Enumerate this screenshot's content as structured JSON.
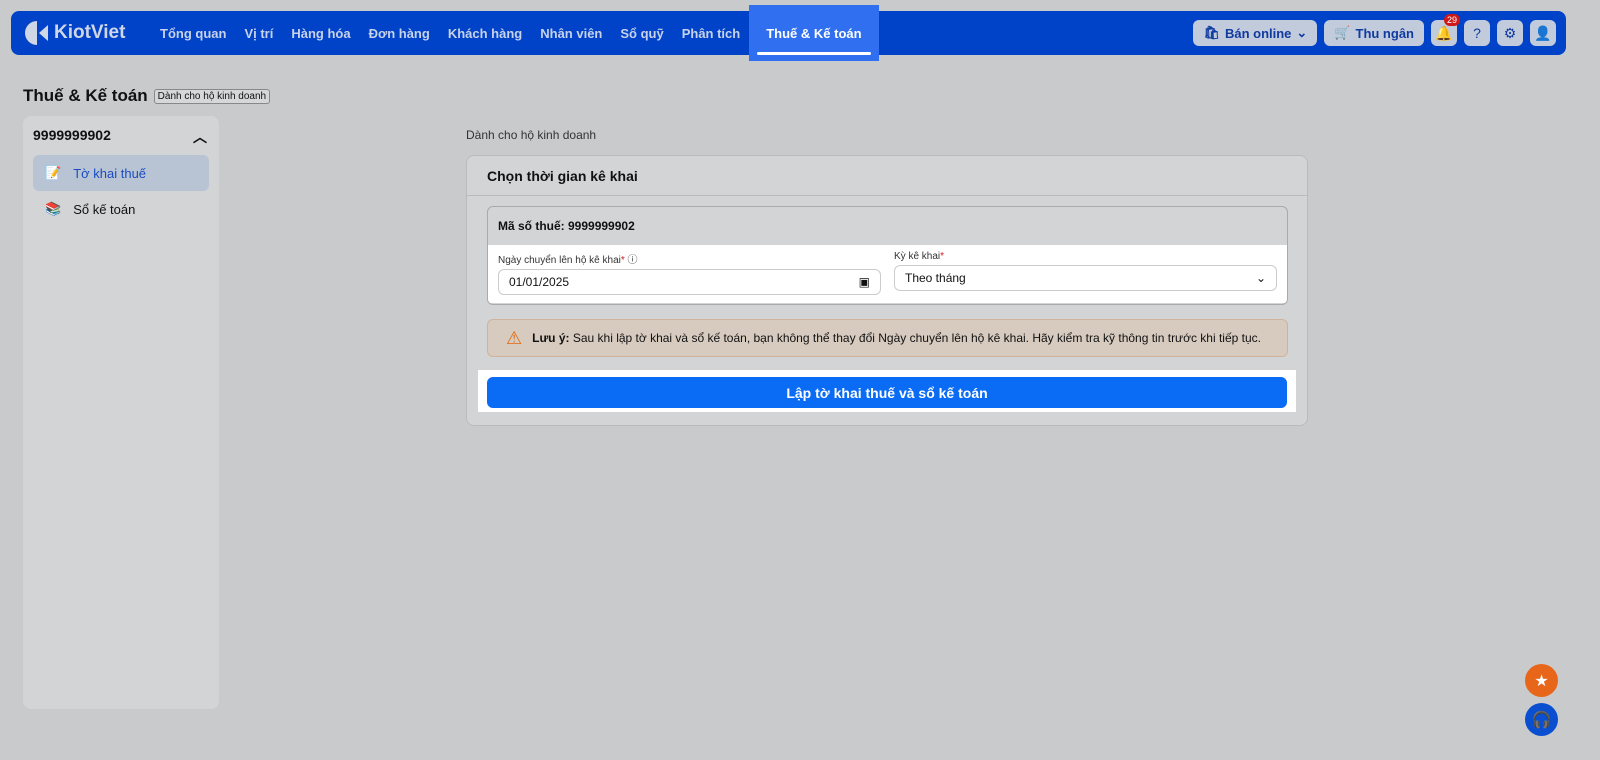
{
  "header": {
    "logo": "KiotViet",
    "nav": [
      "Tổng quan",
      "Vị trí",
      "Hàng hóa",
      "Đơn hàng",
      "Khách hàng",
      "Nhân viên",
      "Sổ quỹ",
      "Phân tích",
      "Thuế & Kế toán"
    ],
    "online": "Bán online",
    "cashier": "Thu ngân",
    "notifications": "29"
  },
  "page": {
    "title": "Thuế & Kế toán",
    "tag": "Dành cho hộ kinh doanh"
  },
  "sidebar": {
    "account": "9999999902",
    "items": [
      {
        "label": "Tờ khai thuế"
      },
      {
        "label": "Sổ kế toán"
      }
    ]
  },
  "main": {
    "label": "Dành cho hộ kinh doanh",
    "card_title": "Chọn thời gian kê khai",
    "tax_id": "Mã số thuế: 9999999902",
    "date_label": "Ngày chuyển lên hộ kê khai",
    "date_value": "01/01/2025",
    "period_label": "Kỳ kê khai",
    "period_value": "Theo tháng",
    "required": "*",
    "warn_bold": "Lưu ý:",
    "warn_text": "Sau khi lập tờ khai và sổ kế toán, bạn không thể thay đổi Ngày chuyển lên hộ kê khai. Hãy kiểm tra kỹ thông tin trước khi tiếp tục.",
    "submit": "Lập tờ khai thuế và sổ kế toán"
  }
}
